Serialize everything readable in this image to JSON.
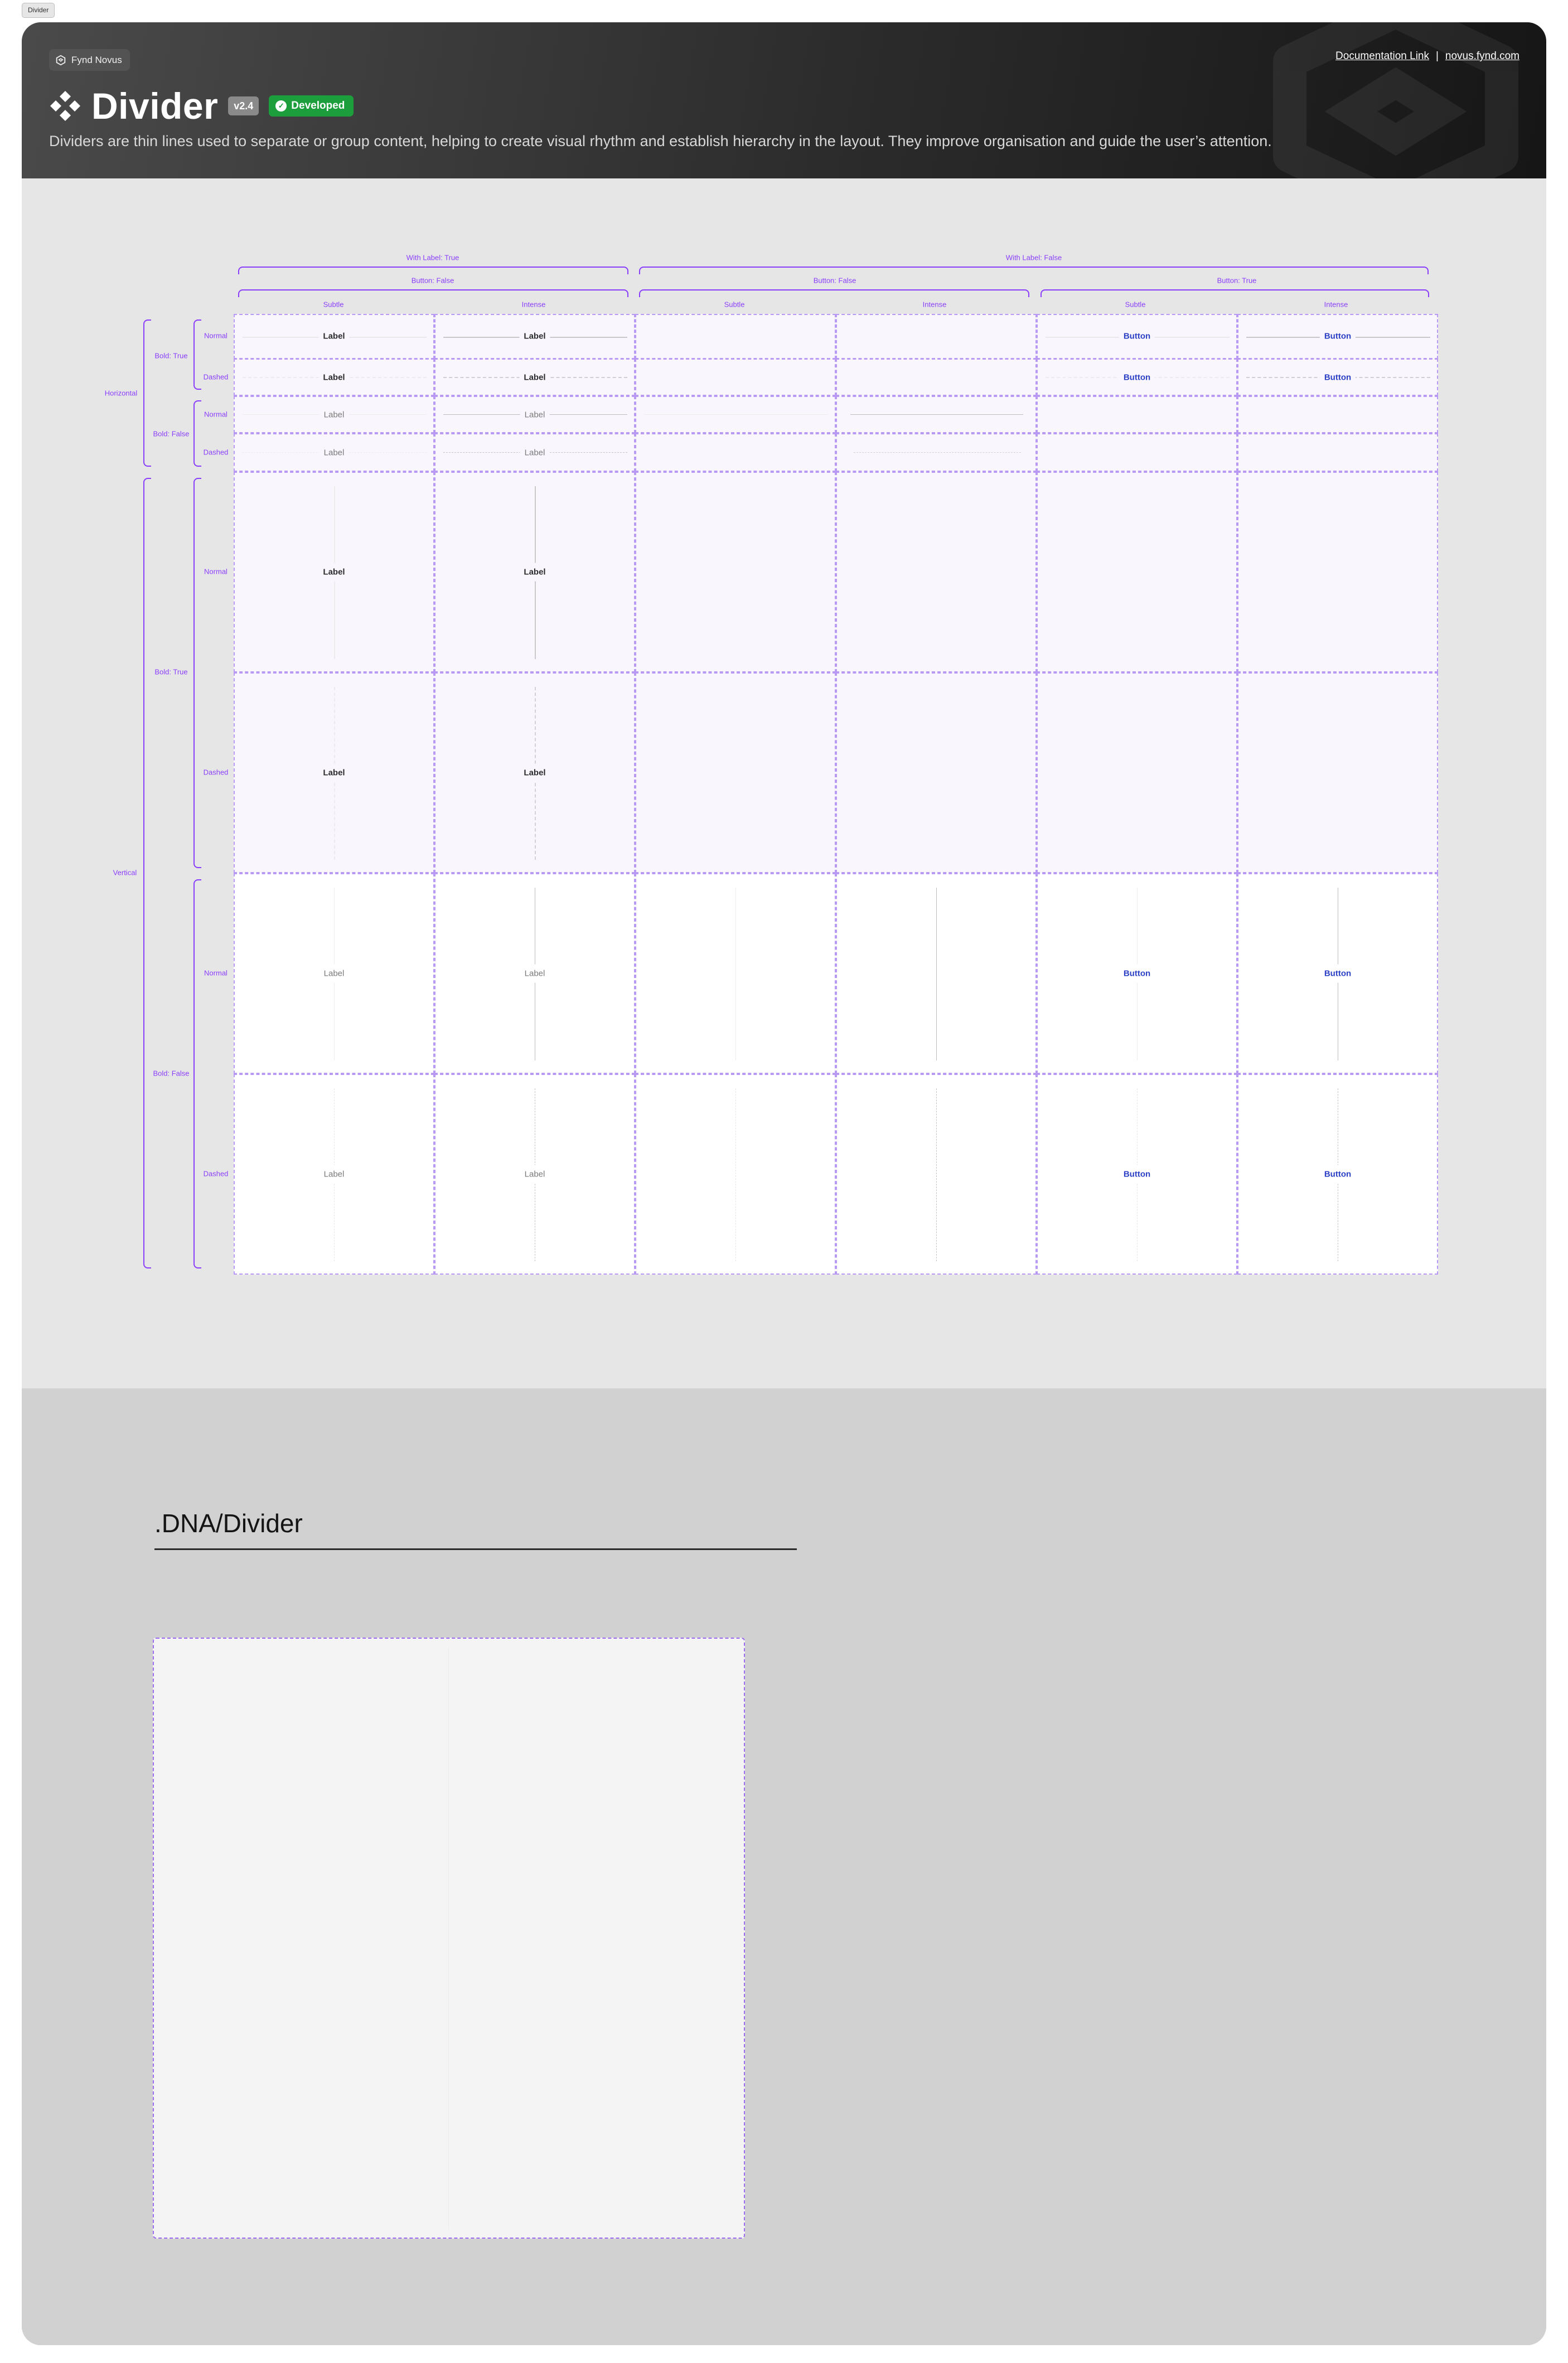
{
  "frame_tag": "Divider",
  "header": {
    "brand": "Fynd Novus",
    "title": "Divider",
    "version": "v2.4",
    "status": "Developed",
    "description": "Dividers are thin lines used to separate or group content, helping to create visual rhythm and establish hierarchy in the layout. They improve organisation and guide the user’s attention.",
    "links": {
      "doc": "Documentation Link",
      "separator": "|",
      "site": "novus.fynd.com"
    }
  },
  "colors": {
    "accent": "#8a3ffc",
    "status_green": "#1c9e3d",
    "button_text": "#2c3fc7",
    "header_dark": "#2b2b2b"
  },
  "icons": {
    "brand": "fynd-logo-icon",
    "title": "component-diamonds-icon",
    "status": "check-circle-icon"
  },
  "matrix": {
    "with_label_true": "With Label: True",
    "with_label_false": "With Label: False",
    "button_false": "Button: False",
    "button_true": "Button: True",
    "subtle": "Subtle",
    "intense": "Intense",
    "horizontal": "Horizontal",
    "vertical": "Vertical",
    "bold_true": "Bold: True",
    "bold_false": "Bold: False",
    "normal": "Normal",
    "dashed": "Dashed",
    "label": "Label",
    "button": "Button"
  },
  "bottom": {
    "title": ".DNA/Divider"
  }
}
